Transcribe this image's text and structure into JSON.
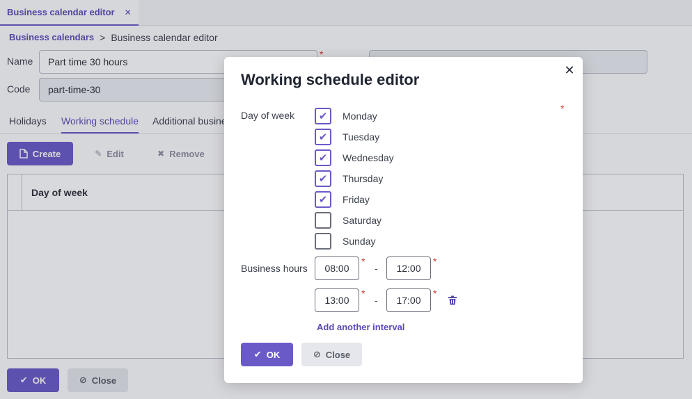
{
  "app_tab": {
    "title": "Business calendar editor"
  },
  "breadcrumb": {
    "parent": "Business calendars",
    "separator": ">",
    "current": "Business calendar editor"
  },
  "form": {
    "name_label": "Name",
    "name_value": "Part time 30 hours",
    "code_label": "Code",
    "code_value": "part-time-30",
    "required_mark": "*"
  },
  "subtabs": [
    "Holidays",
    "Working schedule",
    "Additional busine"
  ],
  "toolbar": {
    "create": "Create",
    "edit": "Edit",
    "remove": "Remove"
  },
  "grid": {
    "columns": [
      "Day of week"
    ]
  },
  "footer": {
    "ok": "OK",
    "close": "Close"
  },
  "dialog": {
    "title": "Working schedule editor",
    "day_of_week_label": "Day of week",
    "days": [
      {
        "label": "Monday",
        "checked": true
      },
      {
        "label": "Tuesday",
        "checked": true
      },
      {
        "label": "Wednesday",
        "checked": true
      },
      {
        "label": "Thursday",
        "checked": true
      },
      {
        "label": "Friday",
        "checked": true
      },
      {
        "label": "Saturday",
        "checked": false
      },
      {
        "label": "Sunday",
        "checked": false
      }
    ],
    "business_hours_label": "Business hours",
    "intervals": [
      {
        "start": "08:00",
        "end": "12:00"
      },
      {
        "start": "13:00",
        "end": "17:00"
      }
    ],
    "interval_separator": "-",
    "add_interval": "Add another interval",
    "ok": "OK",
    "close": "Close"
  },
  "colors": {
    "accent": "#6a5ac8",
    "required": "#d43a3a"
  }
}
